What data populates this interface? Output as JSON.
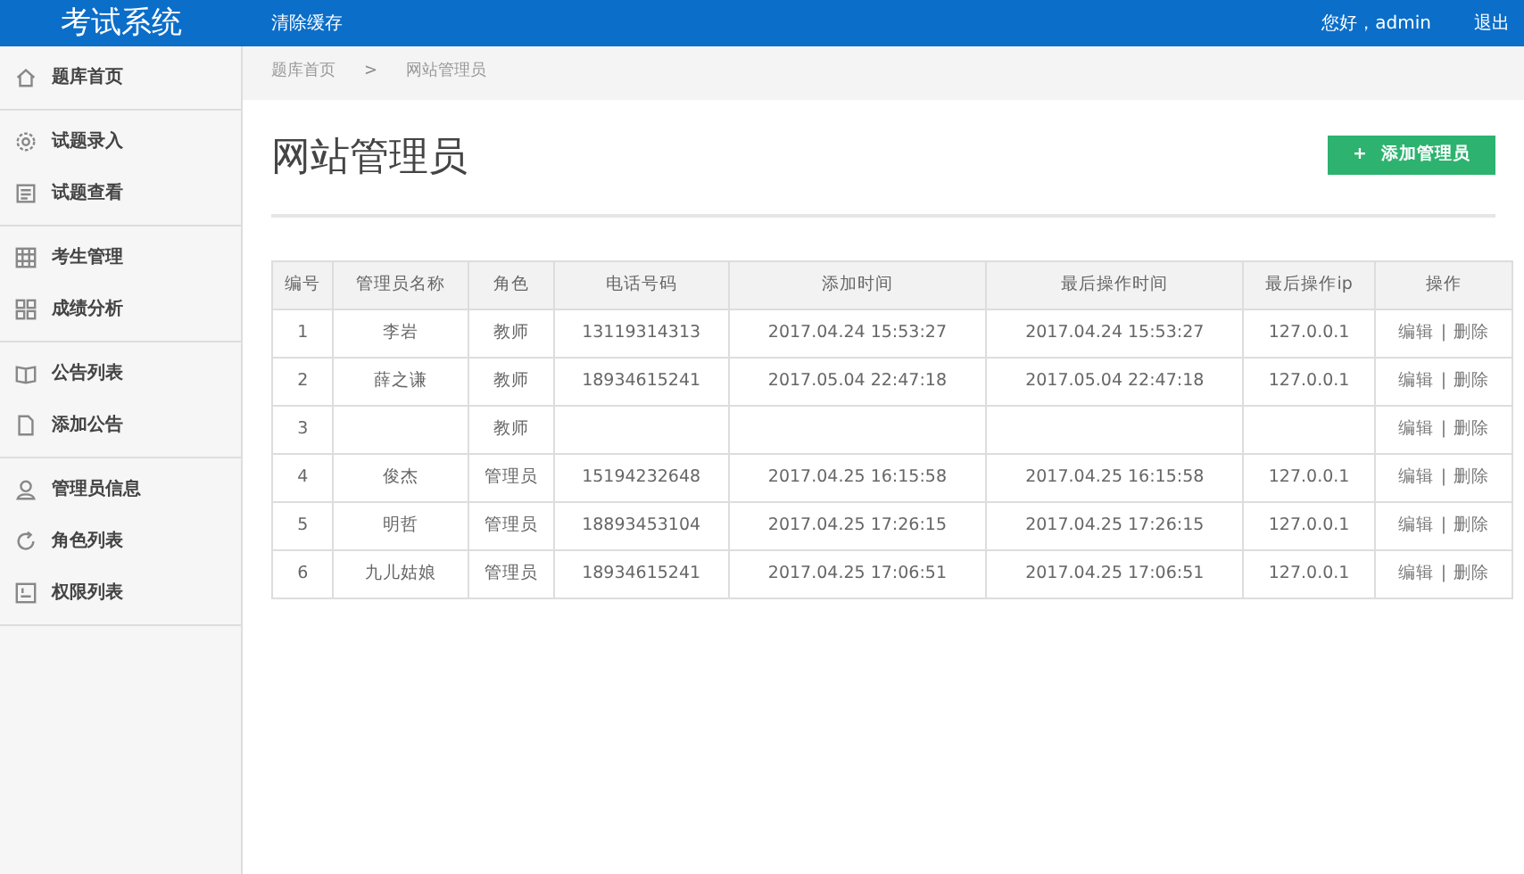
{
  "header": {
    "logo": "考试系统",
    "clear_cache": "清除缓存",
    "greeting": "您好，admin",
    "logout": "退出"
  },
  "sidebar": {
    "groups": [
      {
        "items": [
          {
            "label": "题库首页"
          }
        ]
      },
      {
        "items": [
          {
            "label": "试题录入"
          },
          {
            "label": "试题查看"
          }
        ]
      },
      {
        "items": [
          {
            "label": "考生管理"
          },
          {
            "label": "成绩分析"
          }
        ]
      },
      {
        "items": [
          {
            "label": "公告列表"
          },
          {
            "label": "添加公告"
          }
        ]
      },
      {
        "items": [
          {
            "label": "管理员信息"
          },
          {
            "label": "角色列表"
          },
          {
            "label": "权限列表"
          }
        ]
      }
    ]
  },
  "breadcrumb": {
    "items": [
      "题库首页",
      "网站管理员"
    ],
    "separator": ">"
  },
  "page_title": "网站管理员",
  "add_button": {
    "icon": "+",
    "label": "添加管理员"
  },
  "table": {
    "columns": [
      "编号",
      "管理员名称",
      "角色",
      "电话号码",
      "添加时间",
      "最后操作时间",
      "最后操作ip",
      "操作"
    ],
    "rows": [
      {
        "id": "1",
        "name": "李岩",
        "role": "教师",
        "phone": "13119314313",
        "added": "2017.04.24 15:53:27",
        "last_time": "2017.04.24 15:53:27",
        "ip": "127.0.0.1",
        "actions": [
          "编辑",
          "|",
          "删除"
        ]
      },
      {
        "id": "2",
        "name": "薛之谦",
        "role": "教师",
        "phone": "18934615241",
        "added": "2017.05.04 22:47:18",
        "last_time": "2017.05.04 22:47:18",
        "ip": "127.0.0.1",
        "actions": [
          "编辑",
          "|",
          "删除"
        ]
      },
      {
        "id": "3",
        "role": "教师",
        "actions": [
          "编辑",
          "|",
          "删除"
        ]
      },
      {
        "id": "4",
        "name": "俊杰",
        "role": "管理员",
        "phone": "15194232648",
        "added": "2017.04.25 16:15:58",
        "last_time": "2017.04.25 16:15:58",
        "ip": "127.0.0.1",
        "actions": [
          "编辑",
          "|",
          "删除"
        ]
      },
      {
        "id": "5",
        "name": "明哲",
        "role": "管理员",
        "phone": "18893453104",
        "added": "2017.04.25 17:26:15",
        "last_time": "2017.04.25 17:26:15",
        "ip": "127.0.0.1",
        "actions": [
          "编辑",
          "|",
          "删除"
        ]
      },
      {
        "id": "6",
        "name": "九儿姑娘",
        "role": "管理员",
        "phone": "18934615241",
        "added": "2017.04.25 17:06:51",
        "last_time": "2017.04.25 17:06:51",
        "ip": "127.0.0.1",
        "actions": [
          "编辑",
          "|",
          "删除"
        ]
      }
    ]
  }
}
